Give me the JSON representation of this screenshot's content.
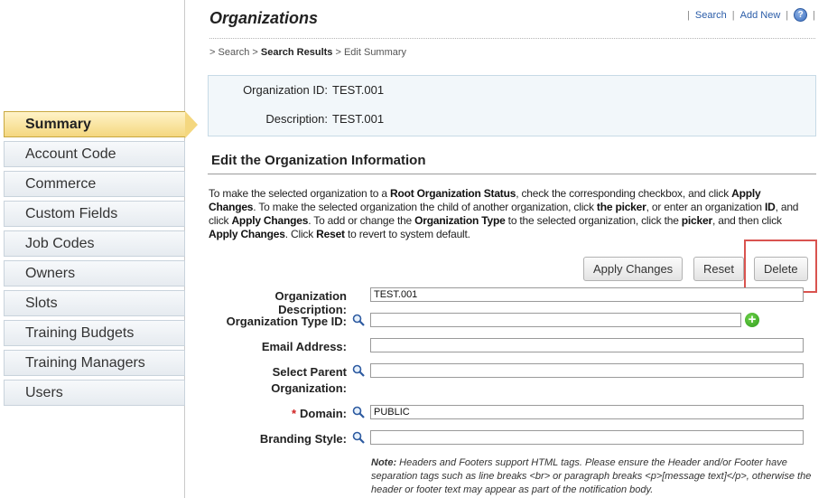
{
  "header": {
    "title": "Organizations",
    "links": {
      "search": "Search",
      "add_new": "Add New",
      "help": "?",
      "separator": "|"
    }
  },
  "breadcrumb": {
    "items": [
      "Search",
      "Search Results",
      "Edit Summary"
    ],
    "separator": ">"
  },
  "info": {
    "org_id_label": "Organization ID:",
    "org_id_value": "TEST.001",
    "description_label": "Description:",
    "description_value": "TEST.001"
  },
  "sidebar": {
    "items": [
      {
        "label": "Summary"
      },
      {
        "label": "Account Code"
      },
      {
        "label": "Commerce"
      },
      {
        "label": "Custom Fields"
      },
      {
        "label": "Job Codes"
      },
      {
        "label": "Owners"
      },
      {
        "label": "Slots"
      },
      {
        "label": "Training Budgets"
      },
      {
        "label": "Training Managers"
      },
      {
        "label": "Users"
      }
    ],
    "active_index": 0
  },
  "section": {
    "title": "Edit the Organization Information",
    "instructions": [
      "To make the selected organization to a ",
      "Root Organization Status",
      ", check the corresponding checkbox, and click ",
      "Apply Changes",
      ". To make the selected organization the child of another organization, click ",
      "the picker",
      ", or enter an organization ",
      "ID",
      ", and click ",
      "Apply Changes",
      ". To add or change the ",
      "Organization Type",
      " to the selected organization, click the ",
      "picker",
      ", and then click ",
      "Apply Changes",
      ". Click ",
      "Reset",
      " to revert to system default."
    ]
  },
  "buttons": {
    "apply": "Apply Changes",
    "reset": "Reset",
    "delete": "Delete"
  },
  "form": {
    "org_description": {
      "label": "Organization Description:",
      "value": "TEST.001"
    },
    "org_type_id": {
      "label": "Organization Type ID:",
      "value": ""
    },
    "email": {
      "label": "Email Address:",
      "value": ""
    },
    "parent_org": {
      "label_line1": "Select Parent",
      "label_line2": "Organization:",
      "value": ""
    },
    "domain": {
      "required_mark": "*",
      "label": "Domain:",
      "value": "PUBLIC"
    },
    "branding": {
      "label": "Branding Style:",
      "value": ""
    }
  },
  "note": {
    "lead": "Note:",
    "text": " Headers and Footers support HTML tags. Please ensure the Header and/or Footer have separation tags such as line breaks <br> or paragraph breaks <p>[message text]</p>, otherwise the header or footer text may appear as part of the notification body."
  },
  "colors": {
    "active_tab": "#f4d77f",
    "link": "#2a5ca8",
    "highlight_box": "#d9534f",
    "info_panel_bg": "#f2f7fa",
    "add_icon": "#2f9a1c"
  }
}
